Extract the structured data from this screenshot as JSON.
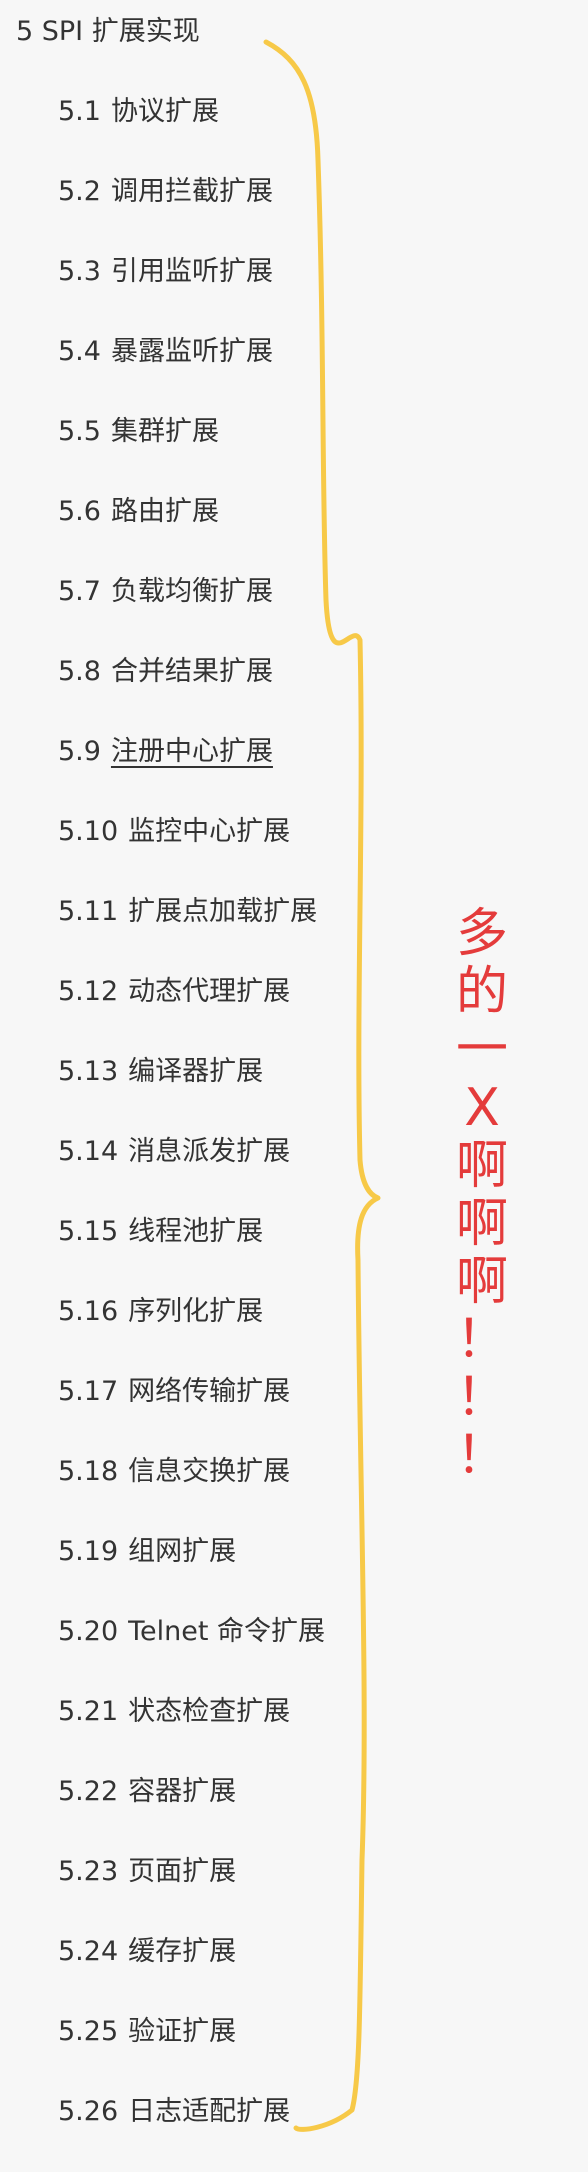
{
  "toc": {
    "title": "5 SPI 扩展实现",
    "items": [
      {
        "num": "5.1",
        "label": "协议扩展"
      },
      {
        "num": "5.2",
        "label": "调用拦截扩展"
      },
      {
        "num": "5.3",
        "label": "引用监听扩展"
      },
      {
        "num": "5.4",
        "label": "暴露监听扩展"
      },
      {
        "num": "5.5",
        "label": "集群扩展"
      },
      {
        "num": "5.6",
        "label": "路由扩展"
      },
      {
        "num": "5.7",
        "label": "负载均衡扩展"
      },
      {
        "num": "5.8",
        "label": "合并结果扩展"
      },
      {
        "num": "5.9",
        "label": "注册中心扩展",
        "active": true
      },
      {
        "num": "5.10",
        "label": "监控中心扩展"
      },
      {
        "num": "5.11",
        "label": "扩展点加载扩展"
      },
      {
        "num": "5.12",
        "label": "动态代理扩展"
      },
      {
        "num": "5.13",
        "label": "编译器扩展"
      },
      {
        "num": "5.14",
        "label": "消息派发扩展"
      },
      {
        "num": "5.15",
        "label": "线程池扩展"
      },
      {
        "num": "5.16",
        "label": "序列化扩展"
      },
      {
        "num": "5.17",
        "label": "网络传输扩展"
      },
      {
        "num": "5.18",
        "label": "信息交换扩展"
      },
      {
        "num": "5.19",
        "label": "组网扩展"
      },
      {
        "num": "5.20",
        "label": "Telnet 命令扩展"
      },
      {
        "num": "5.21",
        "label": "状态检查扩展"
      },
      {
        "num": "5.22",
        "label": "容器扩展"
      },
      {
        "num": "5.23",
        "label": "页面扩展"
      },
      {
        "num": "5.24",
        "label": "缓存扩展"
      },
      {
        "num": "5.25",
        "label": "验证扩展"
      },
      {
        "num": "5.26",
        "label": "日志适配扩展"
      }
    ]
  },
  "annotation": {
    "chars": [
      "多",
      "的",
      "一",
      "X",
      "啊",
      "啊",
      "啊",
      "！",
      "！",
      "！"
    ],
    "color": "#e43b3b"
  },
  "brace": {
    "color": "#f7c948"
  },
  "colors": {
    "background": "#f7f7f7",
    "text": "#333333"
  }
}
